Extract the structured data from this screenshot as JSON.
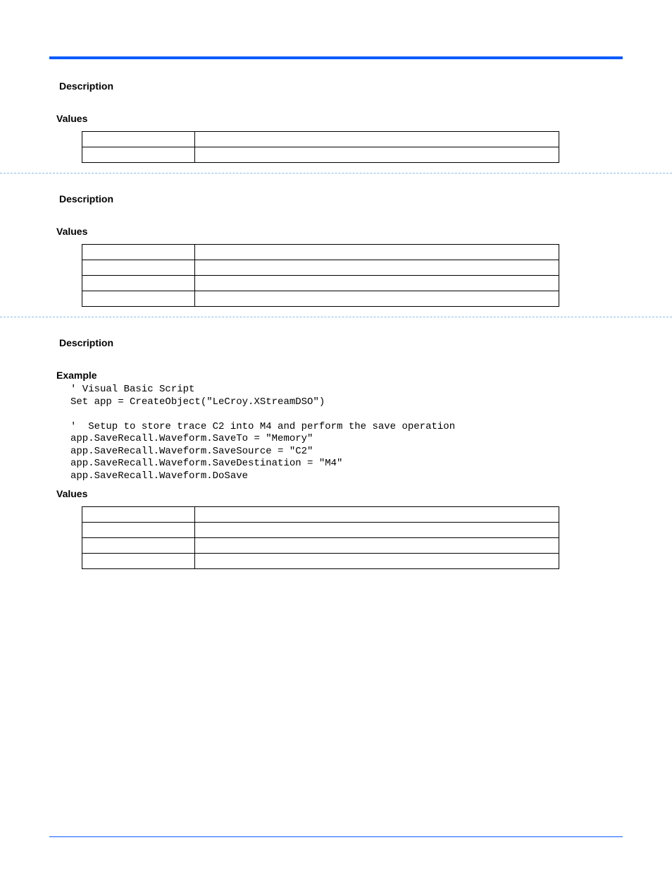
{
  "sections": [
    {
      "description_label": "Description",
      "values_label": "Values",
      "rows": [
        {
          "name": "",
          "desc": ""
        },
        {
          "name": "",
          "desc": ""
        }
      ]
    },
    {
      "description_label": "Description",
      "values_label": "Values",
      "rows": [
        {
          "name": "",
          "desc": ""
        },
        {
          "name": "",
          "desc": ""
        },
        {
          "name": "",
          "desc": ""
        },
        {
          "name": "",
          "desc": ""
        }
      ]
    },
    {
      "description_label": "Description",
      "example_label": "Example",
      "code": "' Visual Basic Script\nSet app = CreateObject(\"LeCroy.XStreamDSO\")\n\n'  Setup to store trace C2 into M4 and perform the save operation\napp.SaveRecall.Waveform.SaveTo = \"Memory\"\napp.SaveRecall.Waveform.SaveSource = \"C2\"\napp.SaveRecall.Waveform.SaveDestination = \"M4\"\napp.SaveRecall.Waveform.DoSave",
      "values_label": "Values",
      "rows": [
        {
          "name": "",
          "desc": ""
        },
        {
          "name": "",
          "desc": ""
        },
        {
          "name": "",
          "desc": ""
        },
        {
          "name": "",
          "desc": ""
        }
      ]
    }
  ]
}
